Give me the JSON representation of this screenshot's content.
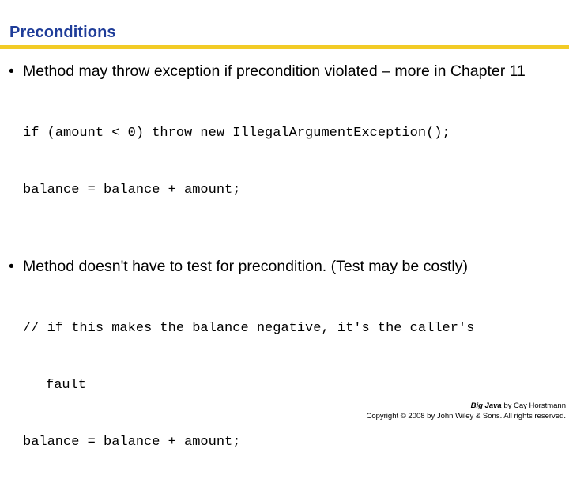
{
  "slide": {
    "title": "Preconditions",
    "accent_title_color": "#1F3D99",
    "accent_rule_color": "#F2CB26",
    "background_color": "#FFFFFF",
    "bullet_marker": "•",
    "content": [
      {
        "type": "bullet",
        "text": "Method may throw exception if precondition violated – more in Chapter 11"
      },
      {
        "type": "code",
        "lines": [
          "if (amount < 0) throw new IllegalArgumentException();",
          "balance = balance + amount;"
        ]
      },
      {
        "type": "bullet",
        "text": "Method doesn't have to test for precondition. (Test may be costly)"
      },
      {
        "type": "code",
        "lines": [
          "// if this makes the balance negative, it's the caller's",
          "fault",
          "balance = balance + amount;"
        ]
      }
    ]
  },
  "footer": {
    "book_title": "Big Java",
    "byline": " by Cay Horstmann",
    "copyright": "Copyright © 2008 by John Wiley & Sons.  All rights reserved."
  }
}
